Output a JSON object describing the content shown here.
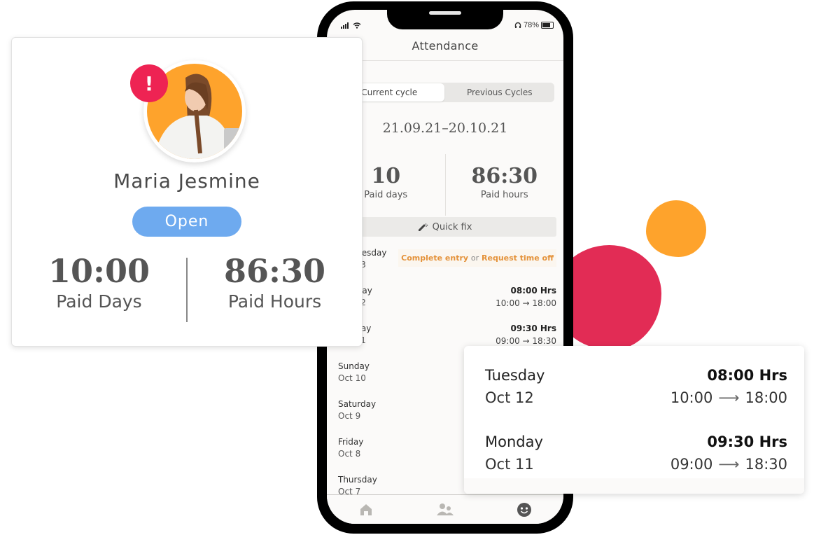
{
  "decor": {
    "red_blob_color": "#e22c55",
    "orange_blob_color": "#fea32c"
  },
  "phone": {
    "status_bar": {
      "battery_percent": "78%",
      "icons": [
        "signal-icon",
        "wifi-icon",
        "headphones-icon",
        "battery-icon"
      ]
    },
    "title": "Attendance",
    "tabs": [
      {
        "label": "Current cycle",
        "active": true
      },
      {
        "label": "Previous Cycles",
        "active": false
      }
    ],
    "cycle_range": "21.09.21–20.10.21",
    "stats": [
      {
        "value": "10",
        "label": "Paid days"
      },
      {
        "value": "86:30",
        "label": "Paid hours"
      }
    ],
    "quick_fix_label": "Quick fix",
    "days": [
      {
        "day": "Wednesday",
        "date": "Oct 13",
        "missing": true,
        "complete_label": "Complete entry",
        "or_label": "or",
        "request_label": "Request time off"
      },
      {
        "day": "Tuesday",
        "date": "Oct 12",
        "hours": "08:00 Hrs",
        "start": "10:00",
        "end": "18:00"
      },
      {
        "day": "Monday",
        "date": "Oct 11",
        "hours": "09:30 Hrs",
        "start": "09:00",
        "end": "18:30"
      },
      {
        "day": "Sunday",
        "date": "Oct 10"
      },
      {
        "day": "Saturday",
        "date": "Oct 9"
      },
      {
        "day": "Friday",
        "date": "Oct 8"
      },
      {
        "day": "Thursday",
        "date": "Oct 7"
      }
    ],
    "bottom_nav": [
      "home-icon",
      "people-icon",
      "smiley-icon"
    ]
  },
  "profile_card": {
    "name": "Maria Jesmine",
    "status": "Open",
    "alert": "!",
    "stats": [
      {
        "value": "10:00",
        "label": "Paid Days"
      },
      {
        "value": "86:30",
        "label": "Paid Hours"
      }
    ]
  },
  "float_card": {
    "rows": [
      {
        "day": "Tuesday",
        "date": "Oct 12",
        "hours": "08:00 Hrs",
        "start": "10:00",
        "arrow": "⟶",
        "end": "18:00"
      },
      {
        "day": "Monday",
        "date": "Oct 11",
        "hours": "09:30 Hrs",
        "start": "09:00",
        "arrow": "⟶",
        "end": "18:30"
      }
    ]
  }
}
